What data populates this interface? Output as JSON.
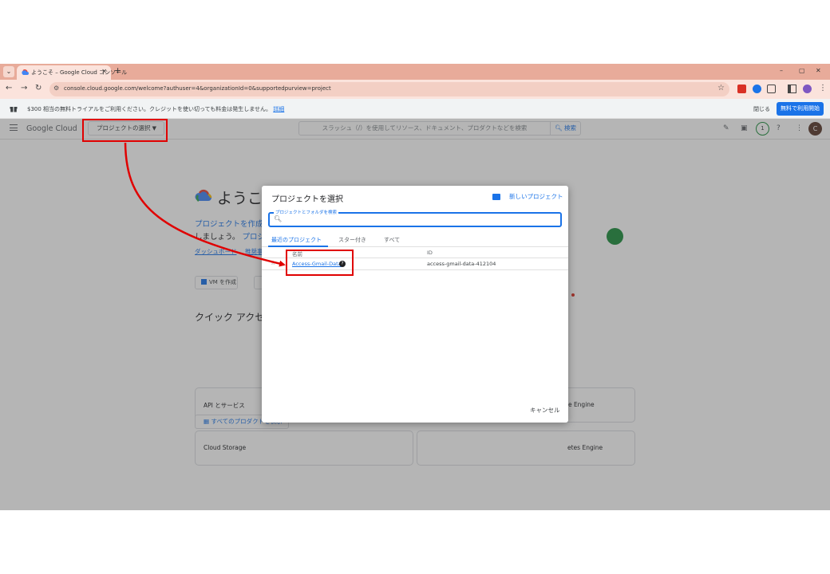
{
  "browser": {
    "tab_title": "ようこそ – Google Cloud コンソール",
    "tab_close": "✕",
    "new_tab": "+",
    "url": "console.cloud.google.com/welcome?authuser=4&organizationId=0&supportedpurview=project",
    "win_min": "–",
    "win_restore": "▢",
    "win_close": "✕"
  },
  "trial_banner": {
    "text": "$300 相当の無料トライアルをご利用ください。クレジットを使い切っても料金は発生しません。",
    "link": "詳細",
    "dismiss": "閉じる",
    "cta": "無料で利用開始"
  },
  "header": {
    "logo": "Google Cloud",
    "project_selector": "プロジェクトの選択",
    "search_placeholder": "スラッシュ（/）を使用してリソース、ドキュメント、プロダクトなどを検索",
    "search_button": "検索",
    "notification_count": "1",
    "avatar_initial": "C"
  },
  "welcome": {
    "title": "ようこ",
    "intro_line1": "プロジェクトを作成",
    "intro_line2a": "しましょう。",
    "intro_line2b": "プロジ",
    "dashboard_link": "ダッシュボード",
    "recommend_link": "推奨事",
    "vm_button": "VM を作成",
    "quick_access": "クイック アクセス",
    "cards": {
      "api": "API とサービス",
      "compute": "te Engine",
      "storage": "Cloud Storage",
      "kubernetes": "etes Engine"
    },
    "all_products": "すべてのプロダクトを表示"
  },
  "dialog": {
    "title": "プロジェクトを選択",
    "new_project": "新しいプロジェクト",
    "search_label": "プロジェクトとフォルダを検索",
    "tabs": [
      "最近のプロジェクト",
      "スター付き",
      "すべて"
    ],
    "columns": {
      "name": "名前",
      "id": "ID"
    },
    "rows": [
      {
        "name": "Access-Gmail-Data",
        "id": "access-gmail-data-412104"
      }
    ],
    "cancel": "キャンセル"
  },
  "colors": {
    "accent": "#1a73e8",
    "highlight": "#e00000",
    "tabbar": "#e8ab9a"
  }
}
